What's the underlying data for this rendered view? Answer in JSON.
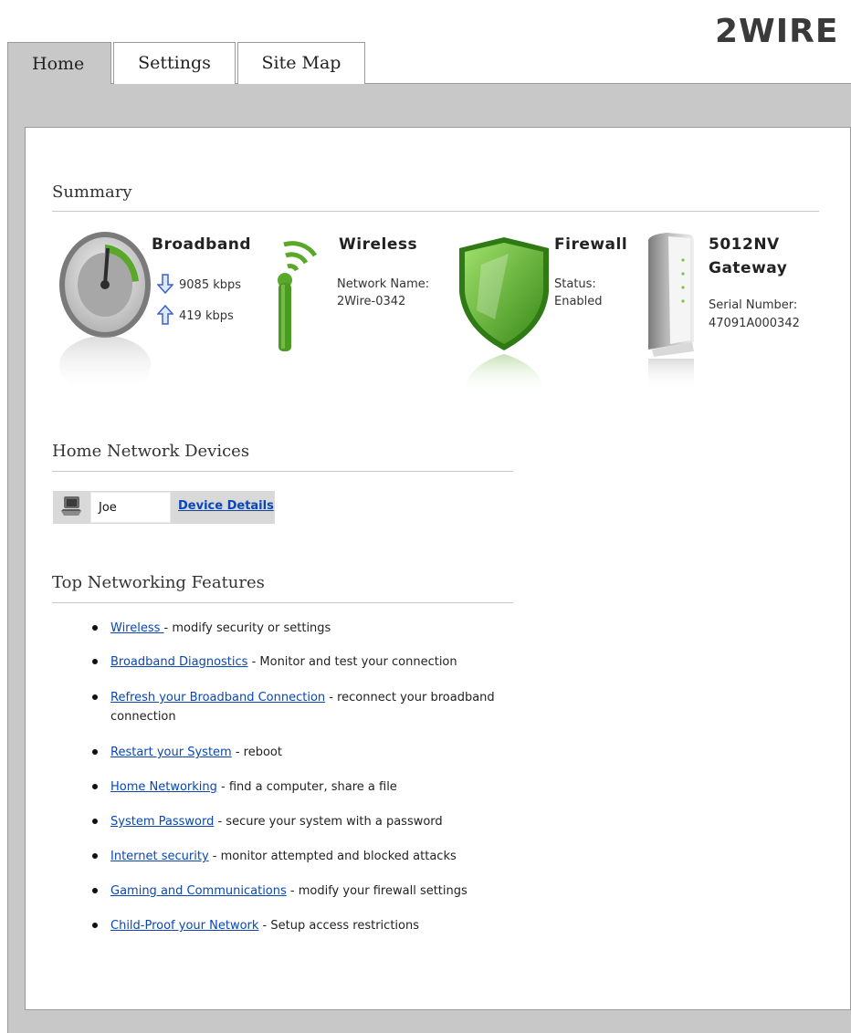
{
  "brand": {
    "logo_text": "2WIRE"
  },
  "tabs": [
    {
      "label": "Home",
      "active": true
    },
    {
      "label": "Settings",
      "active": false
    },
    {
      "label": "Site Map",
      "active": false
    }
  ],
  "summary": {
    "title": "Summary",
    "broadband": {
      "title": "Broadband",
      "down": "9085 kbps",
      "up": "419 kbps"
    },
    "wireless": {
      "title": "Wireless",
      "network_label": "Network Name:",
      "network_name": "2Wire-0342"
    },
    "firewall": {
      "title": "Firewall",
      "status_label": "Status:",
      "status_value": "Enabled"
    },
    "gateway": {
      "title_line1": "5012NV",
      "title_line2": "Gateway",
      "serial_label": "Serial Number:",
      "serial_value": "47091A000342"
    }
  },
  "devices": {
    "title": "Home Network Devices",
    "items": [
      {
        "name": "Joe",
        "details_link": "Device Details"
      }
    ]
  },
  "features": {
    "title": "Top Networking Features",
    "items": [
      {
        "link": "Wireless ",
        "desc": " - modify security or settings"
      },
      {
        "link": "Broadband Diagnostics",
        "desc": " - Monitor and test your connection"
      },
      {
        "link": "Refresh your Broadband Connection",
        "desc": " - reconnect your broadband connection"
      },
      {
        "link": "Restart your System",
        "desc": " - reboot"
      },
      {
        "link": "Home Networking",
        "desc": " - find a computer, share a file"
      },
      {
        "link": "System Password",
        "desc": " - secure your system with a password"
      },
      {
        "link": "Internet security",
        "desc": " - monitor attempted and blocked attacks"
      },
      {
        "link": "Gaming and Communications",
        "desc": " - modify your firewall settings"
      },
      {
        "link": "Child-Proof your Network",
        "desc": " - Setup access restrictions"
      }
    ]
  },
  "colors": {
    "link": "#0a47b5",
    "frame": "#c8c8c8",
    "green": "#5aa82a"
  }
}
